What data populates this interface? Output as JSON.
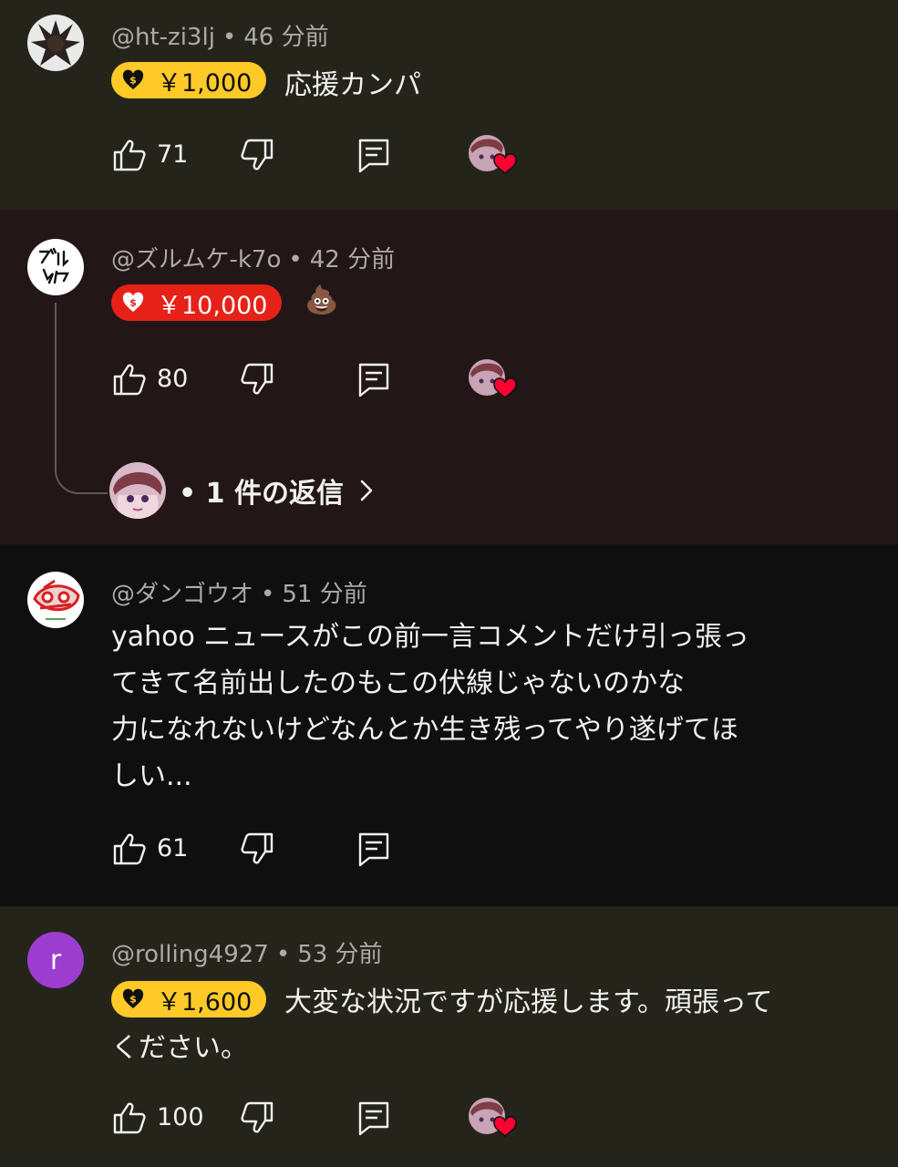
{
  "comments": [
    {
      "author": "@ht-zi3lj",
      "time": "46 分前",
      "superchat_amount": "￥1,000",
      "text": "応援カンパ",
      "likes": "71",
      "chip_color": "#ffca28"
    },
    {
      "author": "@ズルムケ-k7o",
      "time": "42 分前",
      "superchat_amount": "￥10,000",
      "text": "💩",
      "likes": "80",
      "replies_label": "1 件の返信",
      "chip_color": "#e62117"
    },
    {
      "author": "@ダンゴウオ",
      "time": "51 分前",
      "text_lines": [
        "yahoo ニュースがこの前一言コメントだけ引っ張っ",
        "てきて名前出したのもこの伏線じゃないのかな",
        "力になれないけどなんとか生き残ってやり遂げてほ",
        "しい..."
      ],
      "likes": "61"
    },
    {
      "author": "@rolling4927",
      "time": "53 分前",
      "superchat_amount": "￥1,600",
      "text": "大変な状況ですが応援します。頑張って",
      "text_line2": "ください。",
      "likes": "100",
      "avatar_letter": "r",
      "chip_color": "#ffca28"
    }
  ],
  "separator": "•",
  "icons": {
    "like": "thumbs-up-icon",
    "dislike": "thumbs-down-icon",
    "reply": "reply-comment-icon",
    "creator_heart": "creator-heart-icon",
    "chevron": "chevron-right-icon"
  }
}
